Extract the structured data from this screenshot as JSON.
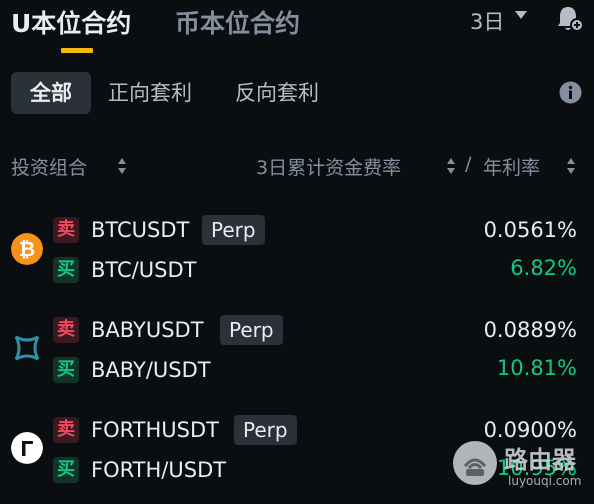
{
  "top_tabs": {
    "usdt_m": "U本位合约",
    "coin_m": "币本位合约"
  },
  "period": "3日",
  "filters": {
    "all": "全部",
    "positive": "正向套利",
    "reverse": "反向套利"
  },
  "table_header": {
    "portfolio": "投资组合",
    "funding": "3日累计资金费率",
    "separator": "/",
    "apr": "年利率"
  },
  "rows": [
    {
      "coin_icon": "btc-icon",
      "sell_tag": "卖",
      "perp_symbol": "BTCUSDT",
      "perp_badge": "Perp",
      "buy_tag": "买",
      "spot_symbol": "BTC/USDT",
      "funding_rate": "0.0561%",
      "apr": "6.82%"
    },
    {
      "coin_icon": "baby-icon",
      "sell_tag": "卖",
      "perp_symbol": "BABYUSDT",
      "perp_badge": "Perp",
      "buy_tag": "买",
      "spot_symbol": "BABY/USDT",
      "funding_rate": "0.0889%",
      "apr": "10.81%"
    },
    {
      "coin_icon": "forth-icon",
      "sell_tag": "卖",
      "perp_symbol": "FORTHUSDT",
      "perp_badge": "Perp",
      "buy_tag": "买",
      "spot_symbol": "FORTH/USDT",
      "funding_rate": "0.0900%",
      "apr": "10.95%"
    }
  ],
  "watermark": {
    "name": "路由器",
    "url": "luyouqi.com"
  },
  "colors": {
    "accent": "#f0b90b",
    "sell": "#f6465d",
    "buy": "#0ecb81",
    "bg": "#0b0e11"
  }
}
